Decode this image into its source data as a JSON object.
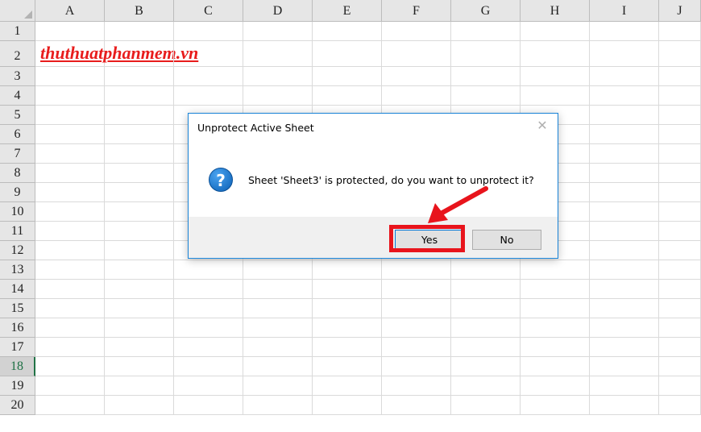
{
  "columns": [
    "A",
    "B",
    "C",
    "D",
    "E",
    "F",
    "G",
    "H",
    "I",
    "J"
  ],
  "rows": [
    "1",
    "2",
    "3",
    "4",
    "5",
    "6",
    "7",
    "8",
    "9",
    "10",
    "11",
    "12",
    "13",
    "14",
    "15",
    "16",
    "17",
    "18",
    "19",
    "20"
  ],
  "active_row": "18",
  "sheet": {
    "brand_text": "thuthuatphanmem.vn",
    "brand_color": "#e81c1c"
  },
  "dialog": {
    "title": "Unprotect Active Sheet",
    "close_symbol": "✕",
    "icon_glyph": "?",
    "message": "Sheet 'Sheet3' is protected, do you want to unprotect it?",
    "yes_label": "Yes",
    "no_label": "No"
  },
  "annotation": {
    "color": "#e8141c"
  }
}
